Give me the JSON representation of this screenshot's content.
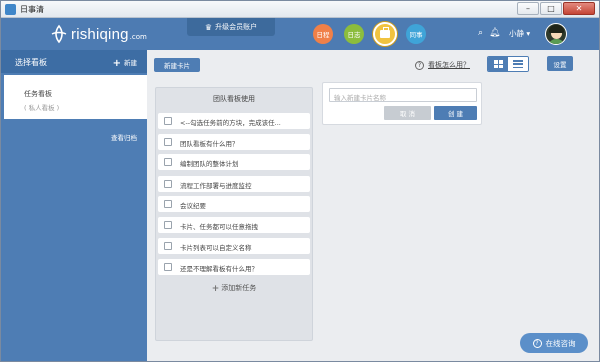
{
  "window": {
    "title": "日事清"
  },
  "header": {
    "logo_text": "rishiqing",
    "logo_domain": ".com",
    "upgrade_label": "升级会员账户",
    "nav": [
      "日程",
      "日志",
      "",
      "同事"
    ],
    "user_name": "小静"
  },
  "sidebar": {
    "title": "选择看板",
    "new_label": "新建",
    "board_name": "任务看板",
    "board_type": "( 私人看板 )",
    "archive_label": "查看归档"
  },
  "toolbar": {
    "new_card_label": "新建卡片",
    "help_label": "看板怎么用？",
    "settings_label": "设置"
  },
  "board": {
    "title": "团队看板使用",
    "tasks": [
      "<--勾选任务前的方块，完成该任...",
      "团队看板有什么用？",
      "编制团队的整体计划",
      "流程工作部署与进度监控",
      "会议纪要",
      "卡片、任务都可以任意拖拽",
      "卡片列表可以自定义名称",
      "还是不理解看板有什么用？"
    ],
    "add_task_label": "添加新任务"
  },
  "new_card": {
    "placeholder": "输入新建卡片名称",
    "cancel_label": "取 消",
    "create_label": "创 建"
  },
  "consult": {
    "label": "在线咨询"
  },
  "colors": {
    "header": "#4d7bb2",
    "accent": "#4e7db4",
    "schedule": "#f08048",
    "log": "#8cbd3d",
    "kanban": "#f1c33f",
    "colleague": "#3fa4d8"
  },
  "icons": {
    "search": "search-icon",
    "bell": "bell-icon",
    "caret": "caret-down-icon",
    "plus": "plus-icon",
    "help": "help-circle-icon",
    "grid": "grid-view-icon",
    "list": "list-view-icon"
  }
}
